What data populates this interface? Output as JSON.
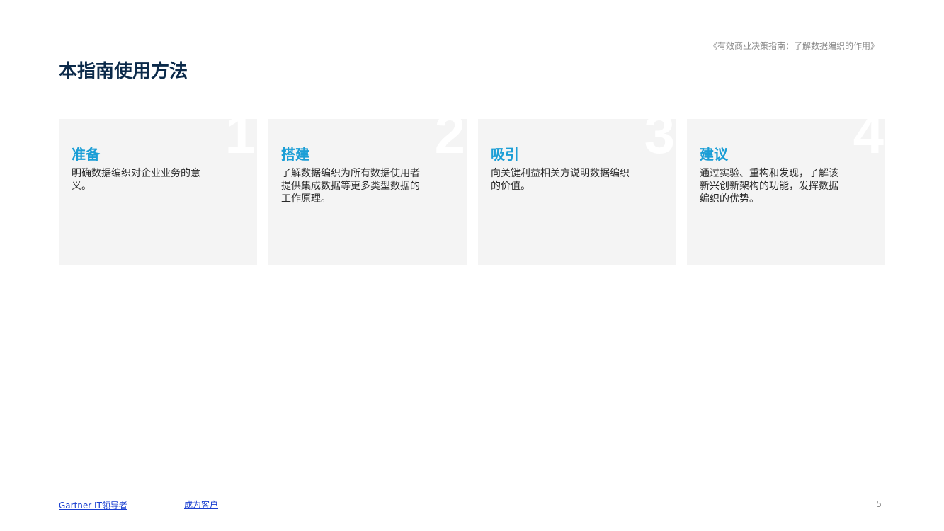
{
  "header": {
    "doc_subtitle": "《有效商业决策指南：了解数据编织的作用》",
    "page_title": "本指南使用方法"
  },
  "cards": [
    {
      "number": "1",
      "title": "准备",
      "description": "明确数据编织对企业业务的意义。"
    },
    {
      "number": "2",
      "title": "搭建",
      "description": "了解数据编织为所有数据使用者提供集成数据等更多类型数据的工作原理。"
    },
    {
      "number": "3",
      "title": "吸引",
      "description": "向关键利益相关方说明数据编织的价值。"
    },
    {
      "number": "4",
      "title": "建议",
      "description": "通过实验、重构和发现，了解该新兴创新架构的功能，发挥数据编织的优势。"
    }
  ],
  "footer": {
    "link_leaders": "Gartner IT领导者",
    "link_become_client": "成为客户",
    "page_number": "5"
  },
  "colors": {
    "title": "#0b2a4a",
    "card_title": "#1b9ed6",
    "card_background": "#f4f4f4",
    "link": "#1a3fd0"
  }
}
